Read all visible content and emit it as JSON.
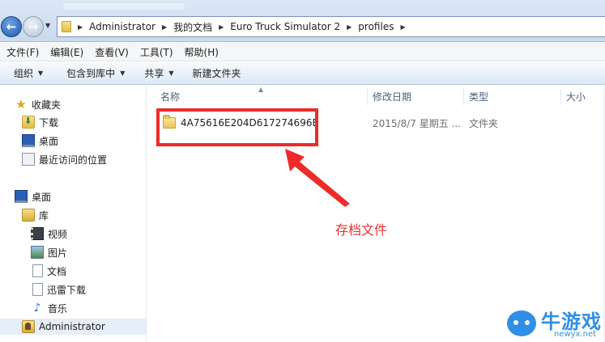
{
  "address_bar": {
    "breadcrumbs": [
      "Administrator",
      "我的文档",
      "Euro Truck Simulator 2",
      "profiles"
    ]
  },
  "menu": {
    "items": [
      "文件(F)",
      "编辑(E)",
      "查看(V)",
      "工具(T)",
      "帮助(H)"
    ]
  },
  "toolbar": {
    "organize": "组织",
    "include_library": "包含到库中",
    "share": "共享",
    "new_folder": "新建文件夹"
  },
  "nav_pane": {
    "favorites": "收藏夹",
    "downloads": "下载",
    "desktop_fav": "桌面",
    "recent": "最近访问的位置",
    "desktop": "桌面",
    "libraries": "库",
    "videos": "视频",
    "pictures": "图片",
    "documents": "文档",
    "thunder": "迅雷下载",
    "music": "音乐",
    "administrator": "Administrator"
  },
  "columns": {
    "name": "名称",
    "modified": "修改日期",
    "type": "类型",
    "size": "大小"
  },
  "files": [
    {
      "name": "4A75616E204D617274696E",
      "modified": "2015/8/7 星期五 ...",
      "type": "文件夹"
    }
  ],
  "annotation": {
    "label": "存档文件",
    "color": "#ee2b2b"
  },
  "watermark": {
    "text": "牛游戏",
    "url": "newyx.net"
  }
}
